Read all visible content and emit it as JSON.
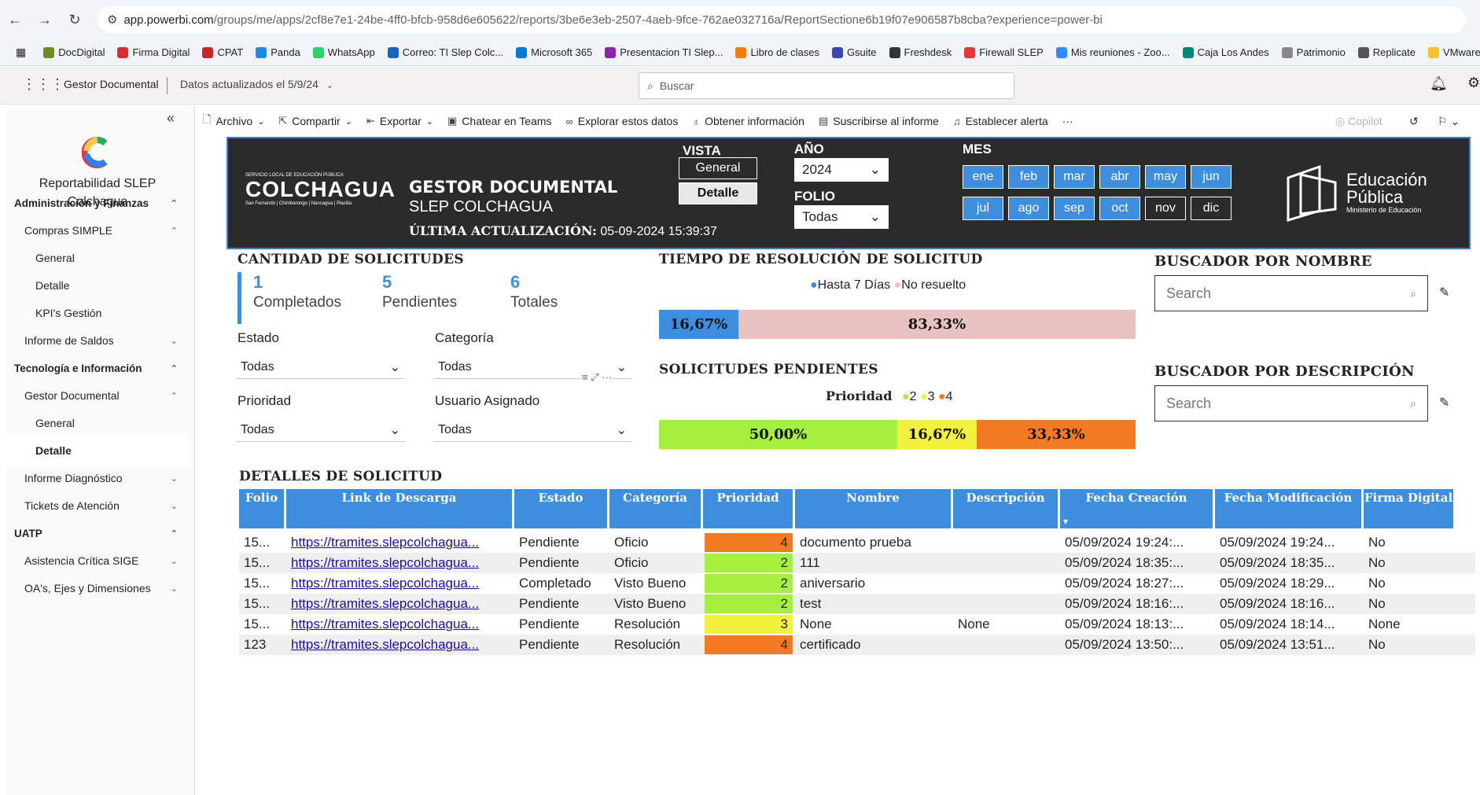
{
  "browser": {
    "url_host": "app.powerbi.com",
    "url_path": "/groups/me/apps/2cf8e7e1-24be-4ff0-bfcb-958d6e605622/reports/3be6e3eb-2507-4aeb-9fce-762ae032716a/ReportSectione6b19f07e906587b8cba?experience=power-bi",
    "bookmarks": [
      "DocDigital",
      "Firma Digital",
      "CPAT",
      "Panda",
      "WhatsApp",
      "Correo: TI Slep Colc...",
      "Microsoft 365",
      "Presentacion TI Slep...",
      "Libro de clases",
      "Gsuite",
      "Freshdesk",
      "Firewall SLEP",
      "Mis reuniones - Zoo...",
      "Caja Los Andes",
      "Patrimonio",
      "Replicate",
      "VMware"
    ]
  },
  "topbar": {
    "app_name": "Gestor Documental",
    "data_updated": "Datos actualizados el 5/9/24",
    "search_placeholder": "Buscar"
  },
  "sidebar": {
    "title": "Reportabilidad SLEP\nColchagua",
    "items": [
      {
        "label": "Administración y Finanzas",
        "level": 0,
        "chev": "^"
      },
      {
        "label": "Compras SIMPLE",
        "level": 1,
        "chev": "^"
      },
      {
        "label": "General",
        "level": 2,
        "chev": ""
      },
      {
        "label": "Detalle",
        "level": 2,
        "chev": ""
      },
      {
        "label": "KPI's Gestión",
        "level": 2,
        "chev": ""
      },
      {
        "label": "Informe de Saldos",
        "level": 1,
        "chev": "v"
      },
      {
        "label": "Tecnología e Información",
        "level": 0,
        "chev": "^"
      },
      {
        "label": "Gestor Documental",
        "level": 1,
        "chev": "^"
      },
      {
        "label": "General",
        "level": 2,
        "chev": ""
      },
      {
        "label": "Detalle",
        "level": 2,
        "chev": "",
        "active": true
      },
      {
        "label": "Informe Diagnóstico",
        "level": 1,
        "chev": "v"
      },
      {
        "label": "Tickets de Atención",
        "level": 1,
        "chev": "v"
      },
      {
        "label": "UATP",
        "level": 0,
        "chev": "^"
      },
      {
        "label": "Asistencia Crítica SIGE",
        "level": 1,
        "chev": "v"
      },
      {
        "label": "OA's, Ejes y Dimensiones",
        "level": 1,
        "chev": "v"
      }
    ]
  },
  "toolbar": {
    "archivo": "Archivo",
    "compartir": "Compartir",
    "exportar": "Exportar",
    "chatear": "Chatear en Teams",
    "explorar": "Explorar estos datos",
    "obtener": "Obtener información",
    "suscribirse": "Suscribirse al informe",
    "alerta": "Establecer alerta",
    "more": "···",
    "copilot": "Copilot"
  },
  "header": {
    "logo_small": "SERVICIO LOCAL DE EDUCACIÓN PÚBLICA",
    "logo_name": "COLCHAGUA",
    "logo_sub": "San Fernando | Chimbarongo | Nancagua | Placilla",
    "title": "GESTOR DOCUMENTAL",
    "subtitle": "SLEP COLCHAGUA",
    "last_update_label": "ÚLTIMA ACTUALIZACIÓN:",
    "last_update_value": "05-09-2024 15:39:37",
    "vista_label": "VISTA",
    "vista_general": "General",
    "vista_detalle": "Detalle",
    "anio_label": "AÑO",
    "anio_value": "2024",
    "folio_label": "FOLIO",
    "folio_value": "Todas",
    "mes_label": "MES",
    "months": [
      "ene",
      "feb",
      "mar",
      "abr",
      "may",
      "jun",
      "jul",
      "ago",
      "sep",
      "oct",
      "nov",
      "dic"
    ],
    "brand_line1": "Educación",
    "brand_line2": "Pública",
    "brand_line3": "Ministerio de Educación"
  },
  "cantidad": {
    "title": "CANTIDAD DE SOLICITUDES",
    "completados": "1",
    "completados_label": "Completados",
    "pendientes": "5",
    "pendientes_label": "Pendientes",
    "totales": "6",
    "totales_label": "Totales"
  },
  "filters": {
    "estado_label": "Estado",
    "estado_value": "Todas",
    "categoria_label": "Categoría",
    "categoria_value": "Todas",
    "prioridad_label": "Prioridad",
    "prioridad_value": "Todas",
    "usuario_label": "Usuario Asignado",
    "usuario_value": "Todas"
  },
  "tiempo": {
    "title": "TIEMPO DE RESOLUCIÓN DE SOLICITUD",
    "legend_a": "Hasta 7 Días",
    "legend_b": "No resuelto",
    "a_pct": "16,67%",
    "b_pct": "83,33%"
  },
  "pendientes": {
    "title": "SOLICITUDES PENDIENTES",
    "legend_title": "Prioridad",
    "l2": "2",
    "l3": "3",
    "l4": "4",
    "p2": "50,00%",
    "p3": "16,67%",
    "p4": "33,33%"
  },
  "buscador": {
    "nombre_title": "BUSCADOR POR NOMBRE",
    "descripcion_title": "BUSCADOR POR DESCRIPCIÓN",
    "placeholder": "Search"
  },
  "detalles": {
    "title": "DETALLES DE SOLICITUD",
    "columns": [
      "Folio",
      "Link de Descarga",
      "Estado",
      "Categoría",
      "Prioridad",
      "Nombre",
      "Descripción",
      "Fecha Creación",
      "Fecha Modificación",
      "Firma Digital"
    ],
    "rows": [
      {
        "folio": "15...",
        "link": "https://tramites.slepcolchagua...",
        "estado": "Pendiente",
        "categoria": "Oficio",
        "prioridad": "4",
        "nombre": "documento prueba",
        "descripcion": "",
        "creacion": "05/09/2024 19:24:...",
        "modificacion": "05/09/2024 19:24...",
        "firma": "No"
      },
      {
        "folio": "15...",
        "link": "https://tramites.slepcolchagua...",
        "estado": "Pendiente",
        "categoria": "Oficio",
        "prioridad": "2",
        "nombre": "111",
        "descripcion": "",
        "creacion": "05/09/2024 18:35:...",
        "modificacion": "05/09/2024 18:35...",
        "firma": "No"
      },
      {
        "folio": "15...",
        "link": "https://tramites.slepcolchagua...",
        "estado": "Completado",
        "categoria": "Visto Bueno",
        "prioridad": "2",
        "nombre": "aniversario",
        "descripcion": "",
        "creacion": "05/09/2024 18:27:...",
        "modificacion": "05/09/2024 18:29...",
        "firma": "No"
      },
      {
        "folio": "15...",
        "link": "https://tramites.slepcolchagua...",
        "estado": "Pendiente",
        "categoria": "Visto Bueno",
        "prioridad": "2",
        "nombre": "test",
        "descripcion": "",
        "creacion": "05/09/2024 18:16:...",
        "modificacion": "05/09/2024 18:16...",
        "firma": "No"
      },
      {
        "folio": "15...",
        "link": "https://tramites.slepcolchagua...",
        "estado": "Pendiente",
        "categoria": "Resolución",
        "prioridad": "3",
        "nombre": "None",
        "descripcion": "None",
        "creacion": "05/09/2024 18:13:...",
        "modificacion": "05/09/2024 18:14...",
        "firma": "None"
      },
      {
        "folio": "123",
        "link": "https://tramites.slepcolchagua...",
        "estado": "Pendiente",
        "categoria": "Resolución",
        "prioridad": "4",
        "nombre": "certificado",
        "descripcion": "",
        "creacion": "05/09/2024 13:50:...",
        "modificacion": "05/09/2024 13:51...",
        "firma": "No"
      }
    ]
  },
  "colors": {
    "accent": "#3e8ee0",
    "p2": "#a4f03c",
    "p3": "#f2f23c",
    "p4": "#f27b22",
    "no_resuelto": "#e8c2c2",
    "header_bg": "#2b2b2b"
  }
}
